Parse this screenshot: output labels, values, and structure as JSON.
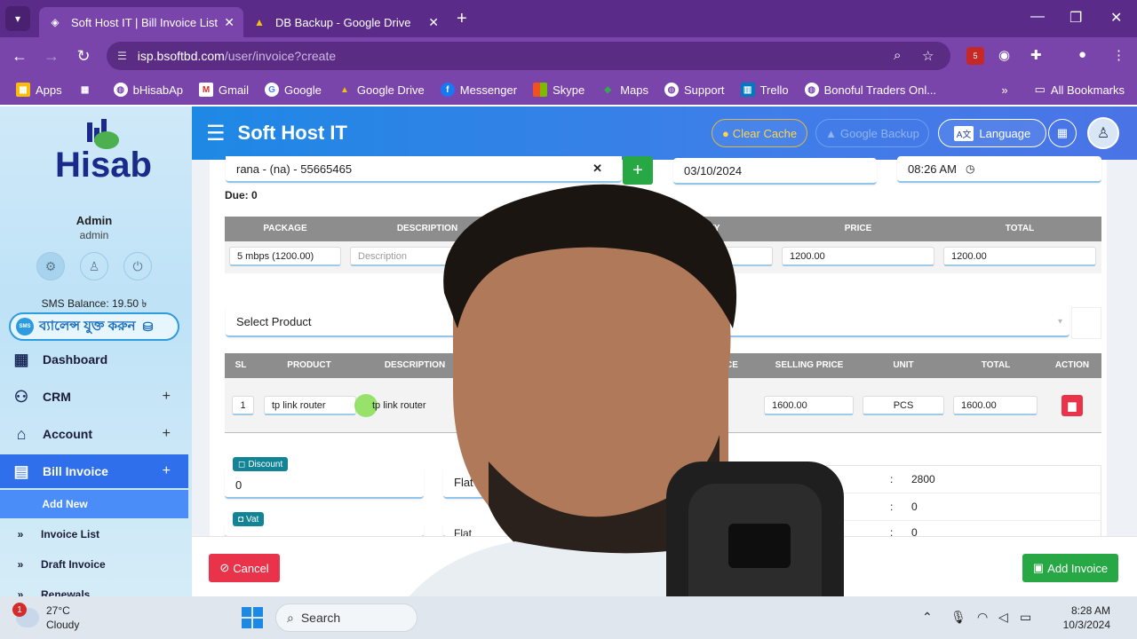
{
  "browser": {
    "tabs": [
      {
        "title": "Soft Host IT | Bill Invoice List",
        "active": true
      },
      {
        "title": "DB Backup - Google Drive",
        "active": false
      }
    ],
    "url_host": "isp.bsoftbd.com",
    "url_path": "/user/invoice?create",
    "extension_badge": "5",
    "bookmarks": [
      "Apps",
      "bHisabAp",
      "Gmail",
      "Google",
      "Google Drive",
      "Messenger",
      "Skype",
      "Maps",
      "Support",
      "Trello",
      "Bonoful Traders Onl..."
    ],
    "all_bookmarks": "All Bookmarks"
  },
  "sidebar": {
    "logo_text": "Hisab",
    "admin_name": "Admin",
    "admin_role": "admin",
    "sms_balance": "SMS Balance: 19.50 ৳",
    "sms_button": "ব্যালেন্স যুক্ত করুন",
    "sms_icon_text": "SMS",
    "menu": [
      {
        "label": "Dashboard",
        "icon": "dashboard-icon"
      },
      {
        "label": "CRM",
        "icon": "users-icon"
      },
      {
        "label": "Account",
        "icon": "bank-icon"
      },
      {
        "label": "Bill Invoice",
        "icon": "invoice-icon"
      }
    ],
    "submenu": [
      {
        "label": "Add New"
      },
      {
        "label": "Invoice List"
      },
      {
        "label": "Draft Invoice"
      },
      {
        "label": "Renewals"
      }
    ]
  },
  "header": {
    "title": "Soft Host IT",
    "clear_cache": "Clear Cache",
    "google_backup": "Google Backup",
    "language": "Language",
    "language_icon_text": "A文"
  },
  "form": {
    "customer": "rana - (na) - 55665465",
    "date": "03/10/2024",
    "time": "08:26 AM",
    "due": "Due: 0",
    "package_table": {
      "headers": [
        "PACKAGE",
        "DESCRIPTION",
        "QUANTITY",
        "PRICE",
        "TOTAL"
      ],
      "row": {
        "package": "5 mbps (1200.00)",
        "description_placeholder": "Description",
        "price": "1200.00",
        "total": "1200.00"
      }
    },
    "select_product": "Select Product",
    "product_table": {
      "headers": [
        "SL",
        "PRODUCT",
        "DESCRIPTION",
        "RICE",
        "SELLING PRICE",
        "UNIT",
        "TOTAL",
        "ACTION"
      ],
      "row": {
        "sl": "1",
        "product": "tp link router",
        "description": "tp link router",
        "selling_price": "1600.00",
        "unit": "PCS",
        "total": "1600.00"
      }
    },
    "discount_label": "Discount",
    "discount_value": "0",
    "vat_label": "Vat",
    "flat_label": "Flat",
    "flat_label_2": "Flat",
    "summary": [
      {
        "colon": ":",
        "value": "2800"
      },
      {
        "colon": ":",
        "value": "0"
      },
      {
        "colon": ":",
        "value": "0"
      }
    ]
  },
  "footer": {
    "cancel": "Cancel",
    "add_invoice": "Add Invoice"
  },
  "taskbar": {
    "weather_badge": "1",
    "temperature": "27°C",
    "condition": "Cloudy",
    "search": "Search",
    "time": "8:28 AM",
    "date": "10/3/2024"
  },
  "colors": {
    "browser_purple": "#7a45ab",
    "header_blue": "#1e88e5",
    "sidebar_active": "#2f6fec",
    "success_green": "#28a745",
    "danger_red": "#e8334a",
    "table_header_gray": "#8d8d8d"
  }
}
